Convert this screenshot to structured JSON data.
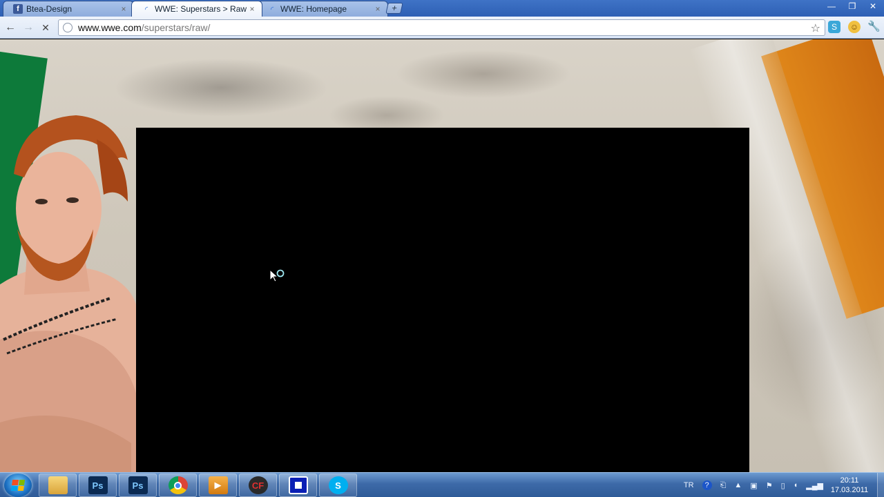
{
  "browser": {
    "tabs": [
      {
        "title": "Btea-Design",
        "icon": "facebook-icon",
        "active": false
      },
      {
        "title": "WWE: Superstars > Raw",
        "icon": "loading-spinner-icon",
        "active": true
      },
      {
        "title": "WWE: Homepage",
        "icon": "loading-spinner-icon",
        "active": false
      }
    ],
    "new_tab_label": "+",
    "address": {
      "host": "www.wwe.com",
      "path": "/superstars/raw/"
    },
    "window_controls": {
      "minimize": "—",
      "restore": "❐",
      "close": "✕"
    }
  },
  "taskbar": {
    "apps": [
      {
        "name": "windows-explorer",
        "label": ""
      },
      {
        "name": "photoshop",
        "label": "Ps"
      },
      {
        "name": "photoshop-2",
        "label": "Ps"
      },
      {
        "name": "chrome",
        "label": ""
      },
      {
        "name": "media-player",
        "label": ""
      },
      {
        "name": "crossfire",
        "label": ""
      },
      {
        "name": "app-blue",
        "label": ""
      },
      {
        "name": "skype",
        "label": "S"
      }
    ],
    "tray": {
      "language": "TR",
      "time": "20:11",
      "date": "17.03.2011"
    }
  },
  "colors": {
    "taskbar": "#3d6aa8",
    "tabstrip": "#2d5fb4",
    "video_bg": "#000000",
    "flag_green": "#0d7a3a",
    "flag_orange": "#e28a1b"
  }
}
